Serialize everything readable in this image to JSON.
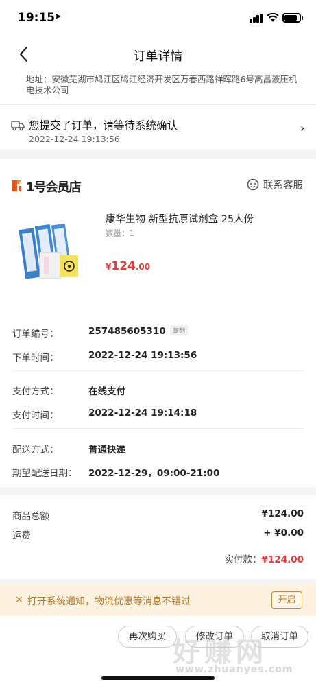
{
  "status_bar": {
    "time": "19:15",
    "location_glyph": "➤"
  },
  "nav": {
    "title": "订单详情"
  },
  "address": {
    "text": "地址：安徽芜湖市鸠江区鸠江经济开发区万春西路祥晖路6号高昌液压机电技术公司"
  },
  "order_status": {
    "title": "您提交了订单，请等待系统确认",
    "time": "2022-12-24 19:13:56",
    "chevron": "›"
  },
  "store": {
    "name": "1号会员店",
    "cs_label": "联系客服"
  },
  "product": {
    "title": "康华生物 新型抗原试剂盒 25人份",
    "qty": "数量：1",
    "price_currency": "¥",
    "price_int": "124",
    "price_dec": ".00"
  },
  "info": {
    "order_no_label": "订单编号：",
    "order_no": "257485605310",
    "copy_label": "复制",
    "order_time_label": "下单时间：",
    "order_time": "2022-12-24 19:13:56",
    "pay_method_label": "支付方式：",
    "pay_method": "在线支付",
    "pay_time_label": "支付时间：",
    "pay_time": "2022-12-24 19:14:18",
    "delivery_label": "配送方式：",
    "delivery": "普通快递",
    "expect_label": "期望配送日期：",
    "expect": "2022-12-29，09:00-21:00"
  },
  "amount": {
    "goods_label": "商品总额",
    "goods_value": "¥124.00",
    "freight_label": "运费",
    "freight_value": "+ ¥0.00",
    "paid_label": "实付款：",
    "paid_value": "¥124.00"
  },
  "notify": {
    "close": "×",
    "text": "打开系统通知，物流优惠等消息不错过",
    "button": "开启"
  },
  "actions": {
    "rebuy": "再次购买",
    "btn2": "修改订单",
    "btn3": "取消订单"
  },
  "watermark": {
    "title": "好赚网",
    "url": "www.zhuanyes.com"
  },
  "colors": {
    "price_red": "#e8393b",
    "notify_text": "#b57a2a",
    "notify_bg": "#fdf2df"
  },
  "icons": [
    "back-icon",
    "truck-icon",
    "store-logo-icon",
    "customer-service-icon",
    "chevron-right-icon"
  ]
}
